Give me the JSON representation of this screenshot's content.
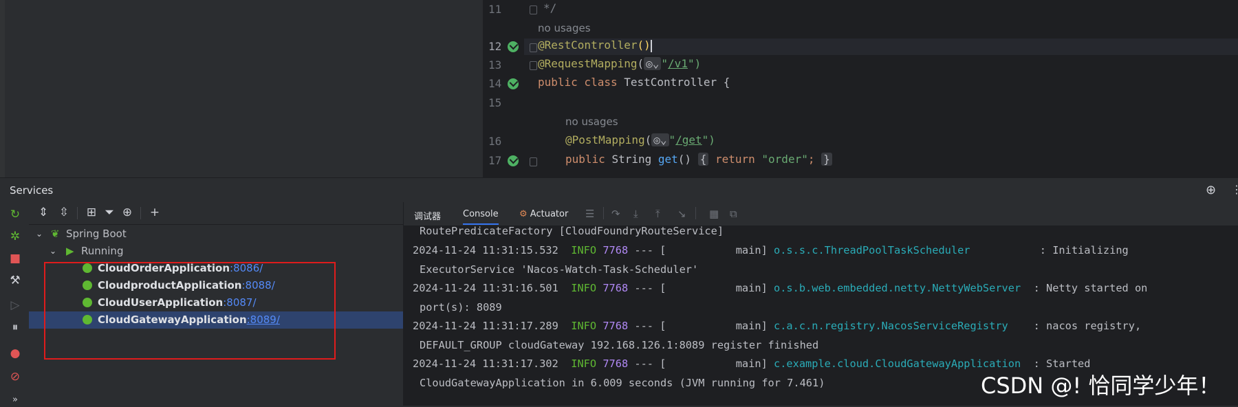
{
  "editor": {
    "lines": [
      {
        "num": "11",
        "text": "*/"
      },
      {
        "num": "12",
        "ann": "@RestController",
        "rest": "()"
      },
      {
        "num": "13",
        "ann": "@RequestMapping",
        "pre": "(",
        "path": "/v1",
        "post": "\")"
      },
      {
        "num": "14",
        "kw": "public class",
        "name": "TestController {"
      },
      {
        "num": "15"
      },
      {
        "num": "16",
        "ann": "@PostMapping",
        "pre": "(",
        "path": "/get",
        "post": "\")"
      },
      {
        "num": "17",
        "kw": "public",
        "type": "String",
        "fn": "get",
        "body_open": "{",
        "ret": "return",
        "val": "\"order\"",
        "semi": ";",
        "body_close": "}"
      }
    ],
    "hint_usage": "no usages"
  },
  "services": {
    "title": "Services",
    "tree": {
      "root": "Spring Boot",
      "group": "Running",
      "apps": [
        {
          "name": "CloudOrderApplication",
          "port": ":8086/"
        },
        {
          "name": "CloudproductApplication",
          "port": ":8088/"
        },
        {
          "name": "CloudUserApplication",
          "port": ":8087/"
        },
        {
          "name": "CloudGatewayApplication",
          "port": ":8089/"
        }
      ],
      "selected_index": 3
    },
    "tabs": [
      "调试器",
      "Console",
      "Actuator"
    ],
    "active_tab": "Console"
  },
  "console": {
    "lines": [
      {
        "cont": "RoutePredicateFactory [CloudFoundryRouteService]"
      },
      {
        "ts": "2024-11-24 11:31:15.532",
        "level": "INFO",
        "pid": "7768",
        "sep": "--- [           main]",
        "cls": "o.s.s.c.ThreadPoolTaskScheduler",
        "msg": "           : Initializing"
      },
      {
        "cont": "ExecutorService 'Nacos-Watch-Task-Scheduler'"
      },
      {
        "ts": "2024-11-24 11:31:16.501",
        "level": "INFO",
        "pid": "7768",
        "sep": "--- [           main]",
        "cls": "o.s.b.web.embedded.netty.NettyWebServer",
        "msg": "  : Netty started on"
      },
      {
        "cont": "port(s): 8089"
      },
      {
        "ts": "2024-11-24 11:31:17.289",
        "level": "INFO",
        "pid": "7768",
        "sep": "--- [           main]",
        "cls": "c.a.c.n.registry.NacosServiceRegistry",
        "msg": "    : nacos registry,"
      },
      {
        "cont": "DEFAULT_GROUP cloudGateway 192.168.126.1:8089 register finished"
      },
      {
        "ts": "2024-11-24 11:31:17.302",
        "level": "INFO",
        "pid": "7768",
        "sep": "--- [           main]",
        "cls": "c.example.cloud.CloudGatewayApplication",
        "msg": "  : Started"
      },
      {
        "cont": "CloudGatewayApplication in 6.009 seconds (JVM running for 7.461)"
      }
    ]
  },
  "watermark": "CSDN @! 恰同学少年！"
}
